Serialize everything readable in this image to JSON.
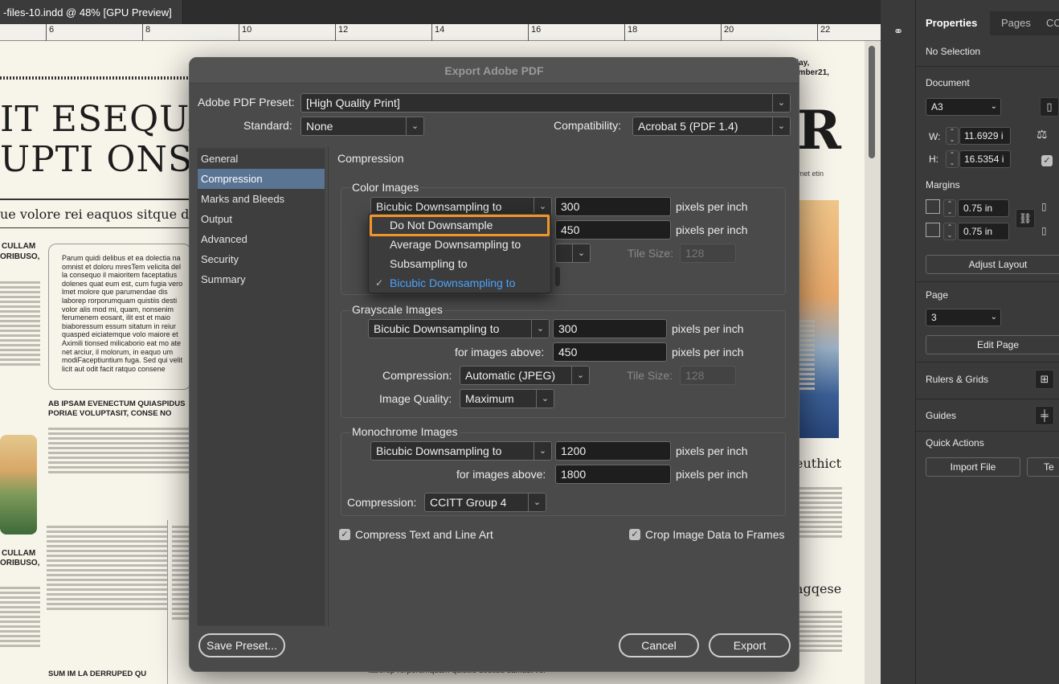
{
  "document": {
    "tab_title": "-files-10.indd @ 48% [GPU Preview]",
    "ruler_ticks": [
      "6",
      "8",
      "10",
      "12",
      "14",
      "16",
      "18",
      "20",
      "22"
    ],
    "headline_1": "IT ESEQUAM",
    "headline_2": "UPTI ONSQU",
    "subhead": "ue volore rei eaquos sitque dolu",
    "kicker_1": "CULLAM",
    "kicker_2": "ORIBUSO,",
    "kicker_3": "CULLAM",
    "kicker_4": "ORIBUSO,",
    "box_text": "Parum quidi delibus et ea dolectia na omnist et doloru mresTem velicita del la consequo il maioritem faceptatius dolenes quat eum est, cum fugia vero lmet molore que parumendae dis laborep rorporumquam quistiis desti volor alis mod mi, quam, nonsenim ferumenem eosant, ilit est et maio biaboressum essum sitatum in reiur quasped eiciatemque volo maiore et Aximili tionsed milicaborio eat mo ate net arciur, il molorum, in eaquo um modiFaceptiuntium fuga. Sed qui velit licit aut odit facit ratquo consene",
    "section_head_1": "AB IPSAM EVENECTUM QUIASPIDUS PORIAE VOLUPTASIT, CONSE NO",
    "section_head_2": "SUM IM LA DERRUPED QU",
    "right_date": "day, ember21,",
    "right_big": "R",
    "right_small": "umet etin",
    "right_head_1": "euthict",
    "right_head_2": "agqese",
    "bottom_text": "laborep rorporumquam quistiis destibu samust vel"
  },
  "dialog": {
    "title": "Export Adobe PDF",
    "preset_label": "Adobe PDF Preset:",
    "preset_value": "[High Quality Print]",
    "standard_label": "Standard:",
    "standard_value": "None",
    "compat_label": "Compatibility:",
    "compat_value": "Acrobat 5 (PDF 1.4)",
    "nav": [
      "General",
      "Compression",
      "Marks and Bleeds",
      "Output",
      "Advanced",
      "Security",
      "Summary"
    ],
    "section_title": "Compression",
    "color": {
      "title": "Color Images",
      "downsample": "Bicubic Downsampling to",
      "ppi": "300",
      "above_value": "450",
      "units": "pixels per inch",
      "tile_label": "Tile Size:",
      "tile_value": "128"
    },
    "dropdown": {
      "options": [
        "Do Not Downsample",
        "Average Downsampling to",
        "Subsampling to",
        "Bicubic Downsampling to"
      ],
      "selected": "Bicubic Downsampling to",
      "check": "✓"
    },
    "gray": {
      "title": "Grayscale Images",
      "downsample": "Bicubic Downsampling to",
      "ppi": "300",
      "above_label": "for images above:",
      "above_value": "450",
      "units": "pixels per inch",
      "compression_label": "Compression:",
      "compression_value": "Automatic (JPEG)",
      "tile_label": "Tile Size:",
      "tile_value": "128",
      "quality_label": "Image Quality:",
      "quality_value": "Maximum"
    },
    "mono": {
      "title": "Monochrome Images",
      "downsample": "Bicubic Downsampling to",
      "ppi": "1200",
      "above_label": "for images above:",
      "above_value": "1800",
      "units": "pixels per inch",
      "compression_label": "Compression:",
      "compression_value": "CCITT Group 4"
    },
    "compress_text": "Compress Text and Line Art",
    "crop_image": "Crop Image Data to Frames",
    "save_preset": "Save Preset...",
    "cancel": "Cancel",
    "export": "Export"
  },
  "panel": {
    "tabs": [
      "Properties",
      "Pages",
      "CC"
    ],
    "no_selection": "No Selection",
    "document_label": "Document",
    "page_size": "A3",
    "w_label": "W:",
    "w_value": "11.6929 i",
    "h_label": "H:",
    "h_value": "16.5354 i",
    "margins_label": "Margins",
    "margin_top": "0.75 in",
    "margin_bottom": "0.75 in",
    "adjust_layout": "Adjust Layout",
    "page_label": "Page",
    "page_value": "3",
    "edit_page": "Edit Page",
    "rulers_grids": "Rulers & Grids",
    "guides": "Guides",
    "quick_actions": "Quick Actions",
    "import_file": "Import File",
    "text_btn": "Te"
  },
  "colors": {
    "accent_highlight": "#f0952b",
    "nav_active": "#5a7594",
    "checked_item": "#4aa3ff"
  }
}
